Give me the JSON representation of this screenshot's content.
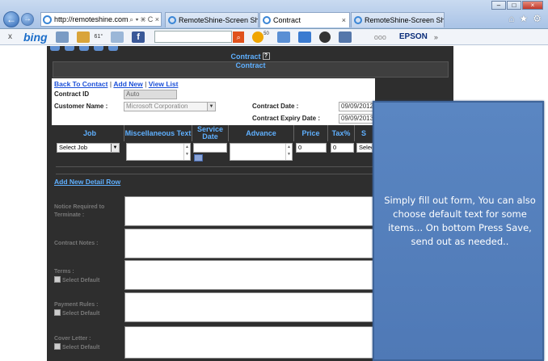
{
  "browser": {
    "address": "http://remoteshine.com",
    "address_tools": "⌕ ▾ ⌘ C ×",
    "tabs": [
      {
        "label": "RemoteShine-Screen Shots"
      },
      {
        "label": "Contract"
      },
      {
        "label": "RemoteShine-Screen Shots"
      }
    ],
    "tab_close": "×",
    "toolbar": {
      "close": "x",
      "bing": "bing",
      "weather": "61°",
      "badge": "50",
      "dots": "ooo",
      "epson": "EPSON",
      "more": "»"
    }
  },
  "page": {
    "title": "Contract",
    "help": "?",
    "subtitle": "Contract",
    "links": {
      "back": "Back To Contact",
      "add_new": "Add New",
      "view_list": "View List",
      "sep": "|"
    },
    "fields": {
      "contract_id_label": "Contract ID",
      "contract_id_value": "Auto",
      "customer_label": "Customer Name :",
      "customer_value": "Microsoft Corporation",
      "contract_date_label": "Contract Date :",
      "contract_date_value": "09/09/2012",
      "expiry_label": "Contract Expiry Date :",
      "expiry_value": "09/09/2013"
    },
    "grid": {
      "headers": [
        "Job",
        "Miscellaneous Text",
        "Service Date",
        "Advance",
        "Price",
        "Tax%",
        "S"
      ],
      "row": {
        "job": "Select Job",
        "price": "0",
        "tax": "0",
        "status": "Selec"
      }
    },
    "add_detail": "Add New Detail Row",
    "sections": [
      {
        "label": "Notice Required to Terminate :",
        "checkbox": ""
      },
      {
        "label": "Contract Notes :",
        "checkbox": ""
      },
      {
        "label": "Terms :",
        "checkbox": "Select Default"
      },
      {
        "label": "Payment Rules :",
        "checkbox": "Select Default"
      },
      {
        "label": "Cover Letter :",
        "checkbox": "Select Default"
      }
    ]
  },
  "callout": {
    "text": "Simply fill out form, You can also choose default text for some items... On bottom Press Save, send out as needed.."
  }
}
